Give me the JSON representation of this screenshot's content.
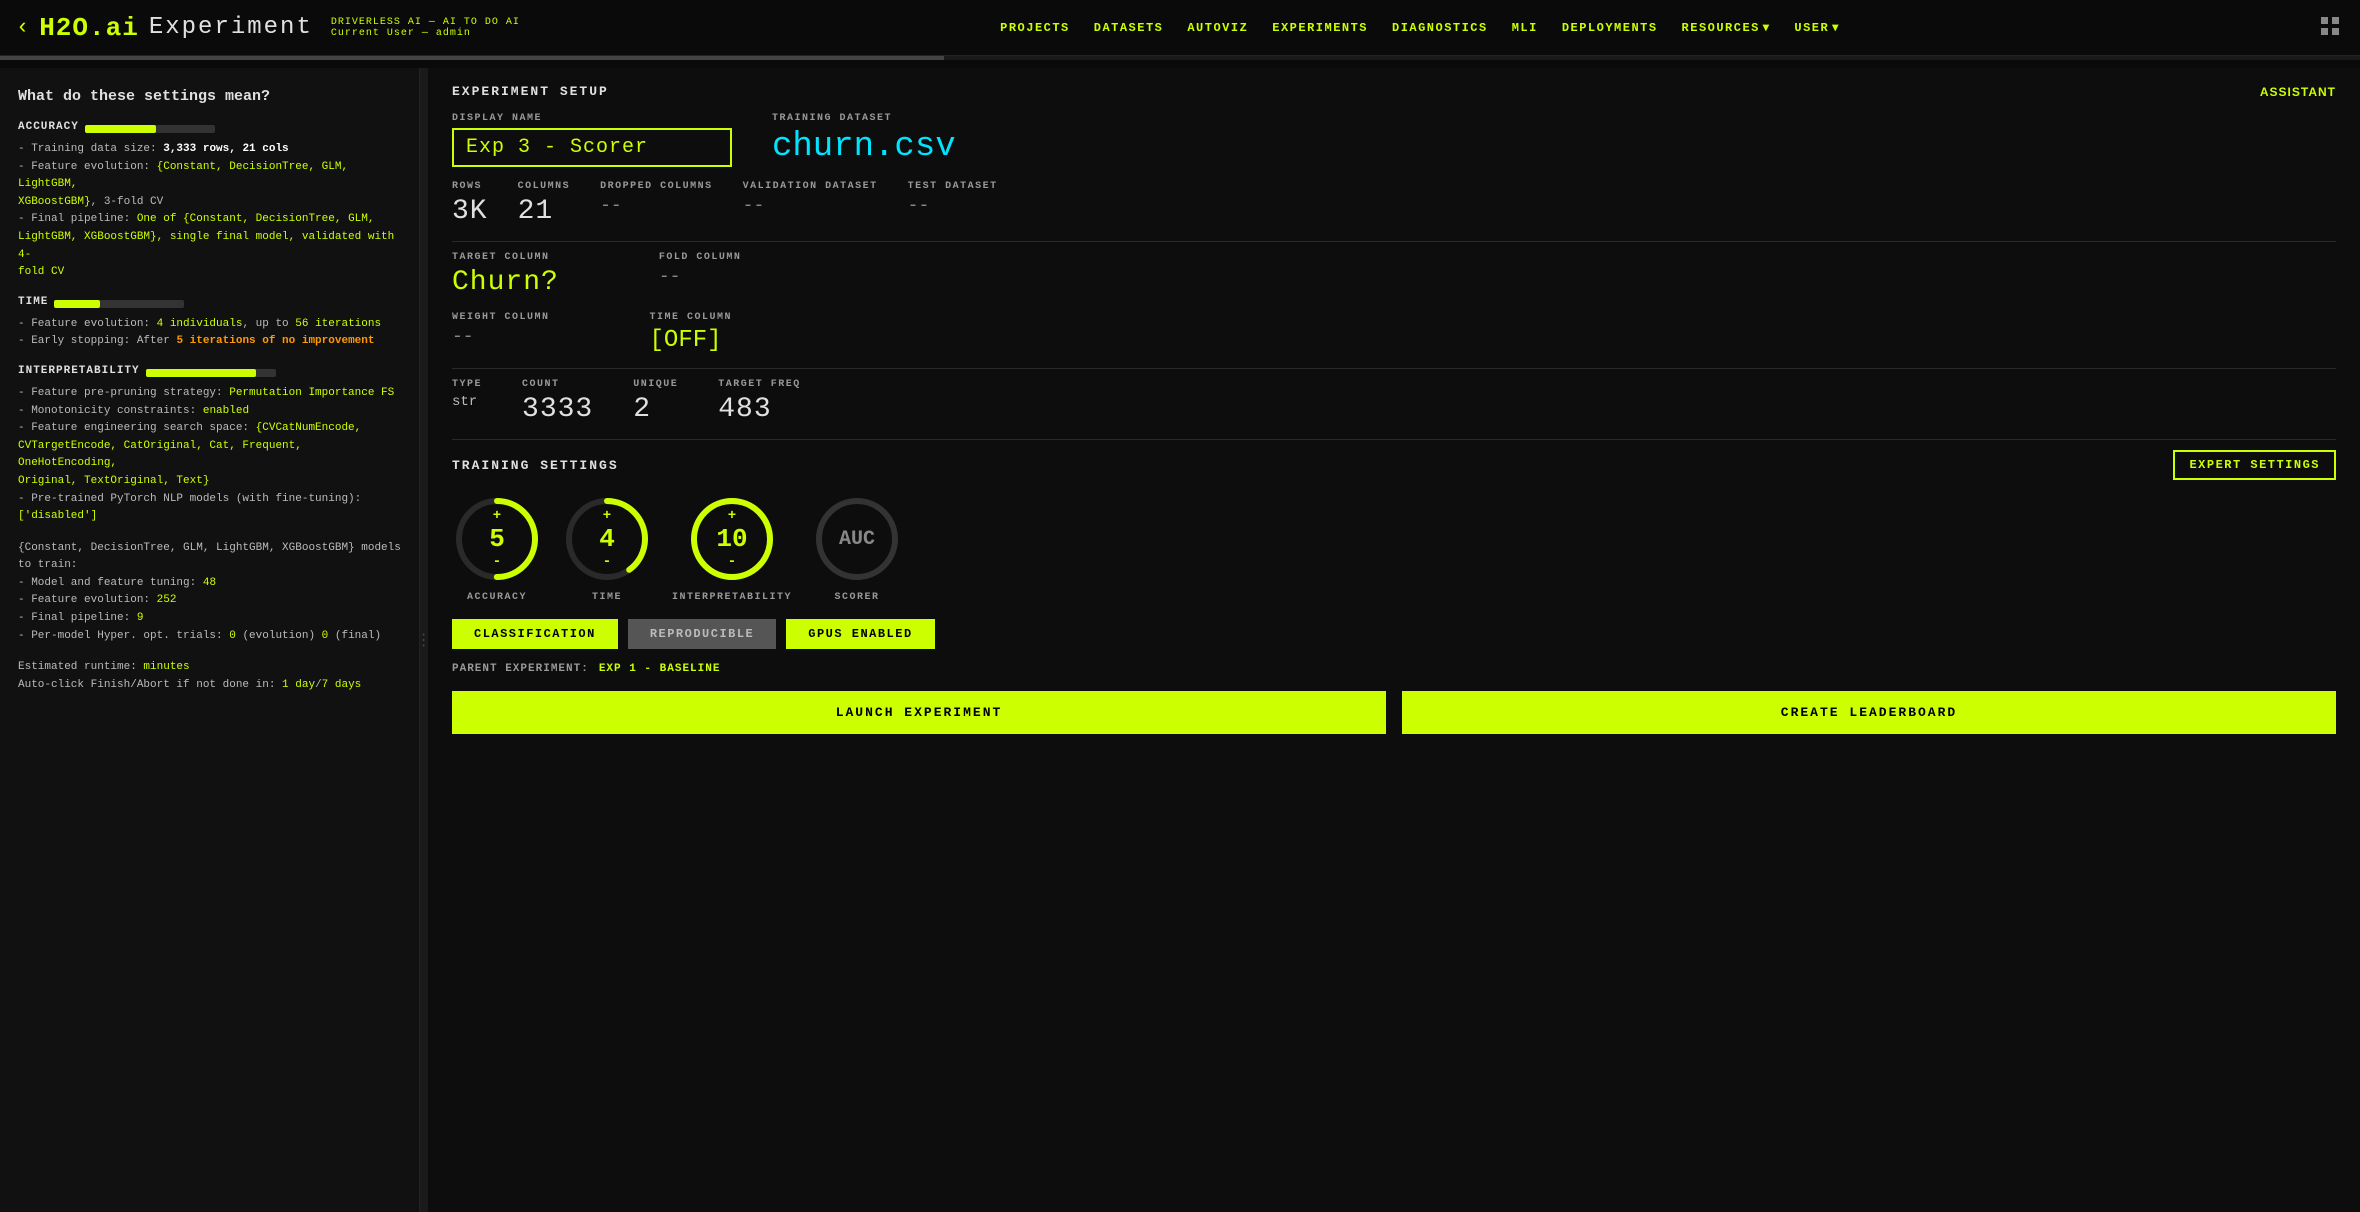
{
  "nav": {
    "back_arrow": "‹",
    "logo": "H2O.ai",
    "title": "Experiment",
    "subtitle_line1": "DRIVERLESS AI  — AI TO DO AI",
    "subtitle_line2": "Current User — admin",
    "links": [
      "PROJECTS",
      "DATASETS",
      "AUTOVIZ",
      "EXPERIMENTS",
      "DIAGNOSTICS",
      "MLI",
      "DEPLOYMENTS",
      "RESOURCES",
      "USER"
    ],
    "resources_arrow": "▾",
    "user_arrow": "▾"
  },
  "sidebar": {
    "title": "What do these settings mean?",
    "accuracy": {
      "label": "ACCURACY",
      "bar_width": "55%",
      "lines": [
        "- Training data size: 3,333 rows, 21 cols",
        "- Feature evolution: {Constant, DecisionTree, GLM, LightGBM,",
        "  XGBoostGBM}, 3-fold CV",
        "- Final pipeline: One of {Constant, DecisionTree, GLM,",
        "  LightGBM, XGBoostGBM}, single final model, validated with 4-",
        "  fold CV"
      ]
    },
    "time": {
      "label": "TIME",
      "bar_width": "35%",
      "lines": [
        "- Feature evolution: 4 individuals, up to 56 iterations",
        "- Early stopping: After 5 iterations of no improvement"
      ]
    },
    "interpretability": {
      "label": "INTERPRETABILITY",
      "bar_width": "75%",
      "lines": [
        "- Feature pre-pruning strategy: Permutation Importance FS",
        "- Monotonicity constraints: enabled",
        "- Feature engineering search space: {CVCatNumEncode,",
        "  CVTargetEncode, CatOriginal, Cat, Frequent, OneHotEncoding,",
        "  Original, TextOriginal, Text}",
        "- Pre-trained PyTorch NLP models (with fine-tuning):",
        "  ['disabled']"
      ]
    },
    "models_block": {
      "lines": [
        "{Constant, DecisionTree, GLM, LightGBM, XGBoostGBM} models",
        "to train:",
        "- Model and feature tuning: 48",
        "- Feature evolution: 252",
        "- Final pipeline: 9",
        "- Per-model Hyper. opt. trials: 0 (evolution) 0 (final)"
      ]
    },
    "runtime": {
      "lines": [
        "Estimated runtime: minutes",
        "Auto-click Finish/Abort if not done in: 1 day/7 days"
      ]
    }
  },
  "experiment_setup": {
    "section_title": "EXPERIMENT SETUP",
    "assistant_label": "ASSISTANT",
    "display_name_label": "DISPLAY NAME",
    "display_name_value": "Exp 3 - Scorer",
    "training_dataset_label": "TRAINING DATASET",
    "training_dataset_value": "churn.csv",
    "rows_label": "ROWS",
    "rows_value": "3K",
    "columns_label": "COLUMNS",
    "columns_value": "21",
    "dropped_columns_label": "DROPPED COLUMNS",
    "dropped_columns_value": "--",
    "validation_dataset_label": "VALIDATION DATASET",
    "validation_dataset_value": "--",
    "test_dataset_label": "TEST DATASET",
    "test_dataset_value": "--",
    "target_column_label": "TARGET COLUMN",
    "target_column_value": "Churn?",
    "fold_column_label": "FOLD COLUMN",
    "fold_column_value": "--",
    "weight_column_label": "WEIGHT COLUMN",
    "weight_column_value": "--",
    "time_column_label": "TIME COLUMN",
    "time_column_value": "[OFF]",
    "type_label": "TYPE",
    "type_value": "str",
    "count_label": "COUNT",
    "count_value": "3333",
    "unique_label": "UNIQUE",
    "unique_value": "2",
    "target_freq_label": "TARGET FREQ",
    "target_freq_value": "483"
  },
  "training_settings": {
    "section_title": "TRAINING SETTINGS",
    "expert_settings_label": "EXPERT SETTINGS",
    "accuracy": {
      "value": "5",
      "label": "ACCURACY",
      "plus": "+",
      "minus": "-",
      "arc_pct": 0.5
    },
    "time": {
      "value": "4",
      "label": "TIME",
      "plus": "+",
      "minus": "-",
      "arc_pct": 0.4
    },
    "interpretability": {
      "value": "10",
      "label": "INTERPRETABILITY",
      "plus": "+",
      "minus": "-",
      "arc_pct": 1.0
    },
    "scorer": {
      "value": "AUC",
      "label": "SCORER",
      "plus": "",
      "minus": "",
      "arc_pct": 0.0
    },
    "classification_label": "CLASSIFICATION",
    "reproducible_label": "REPRODUCIBLE",
    "gpus_enabled_label": "GPUS ENABLED",
    "parent_exp_label": "PARENT EXPERIMENT:",
    "parent_exp_value": "EXP 1 - BASELINE",
    "launch_label": "LAUNCH EXPERIMENT",
    "leaderboard_label": "CREATE LEADERBOARD"
  }
}
